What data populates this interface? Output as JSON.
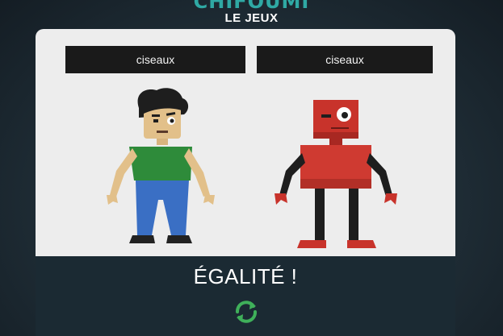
{
  "header": {
    "title": "CHIFOUMI",
    "subtitle": "LE JEUX"
  },
  "game": {
    "player_choice": "ciseaux",
    "cpu_choice": "ciseaux",
    "result": "ÉGALITÉ !"
  },
  "icons": {
    "replay": "refresh-icon"
  },
  "colors": {
    "title": "#2fa9a4",
    "replay_icon": "#3fb05a",
    "panel": "#1b2a33"
  }
}
